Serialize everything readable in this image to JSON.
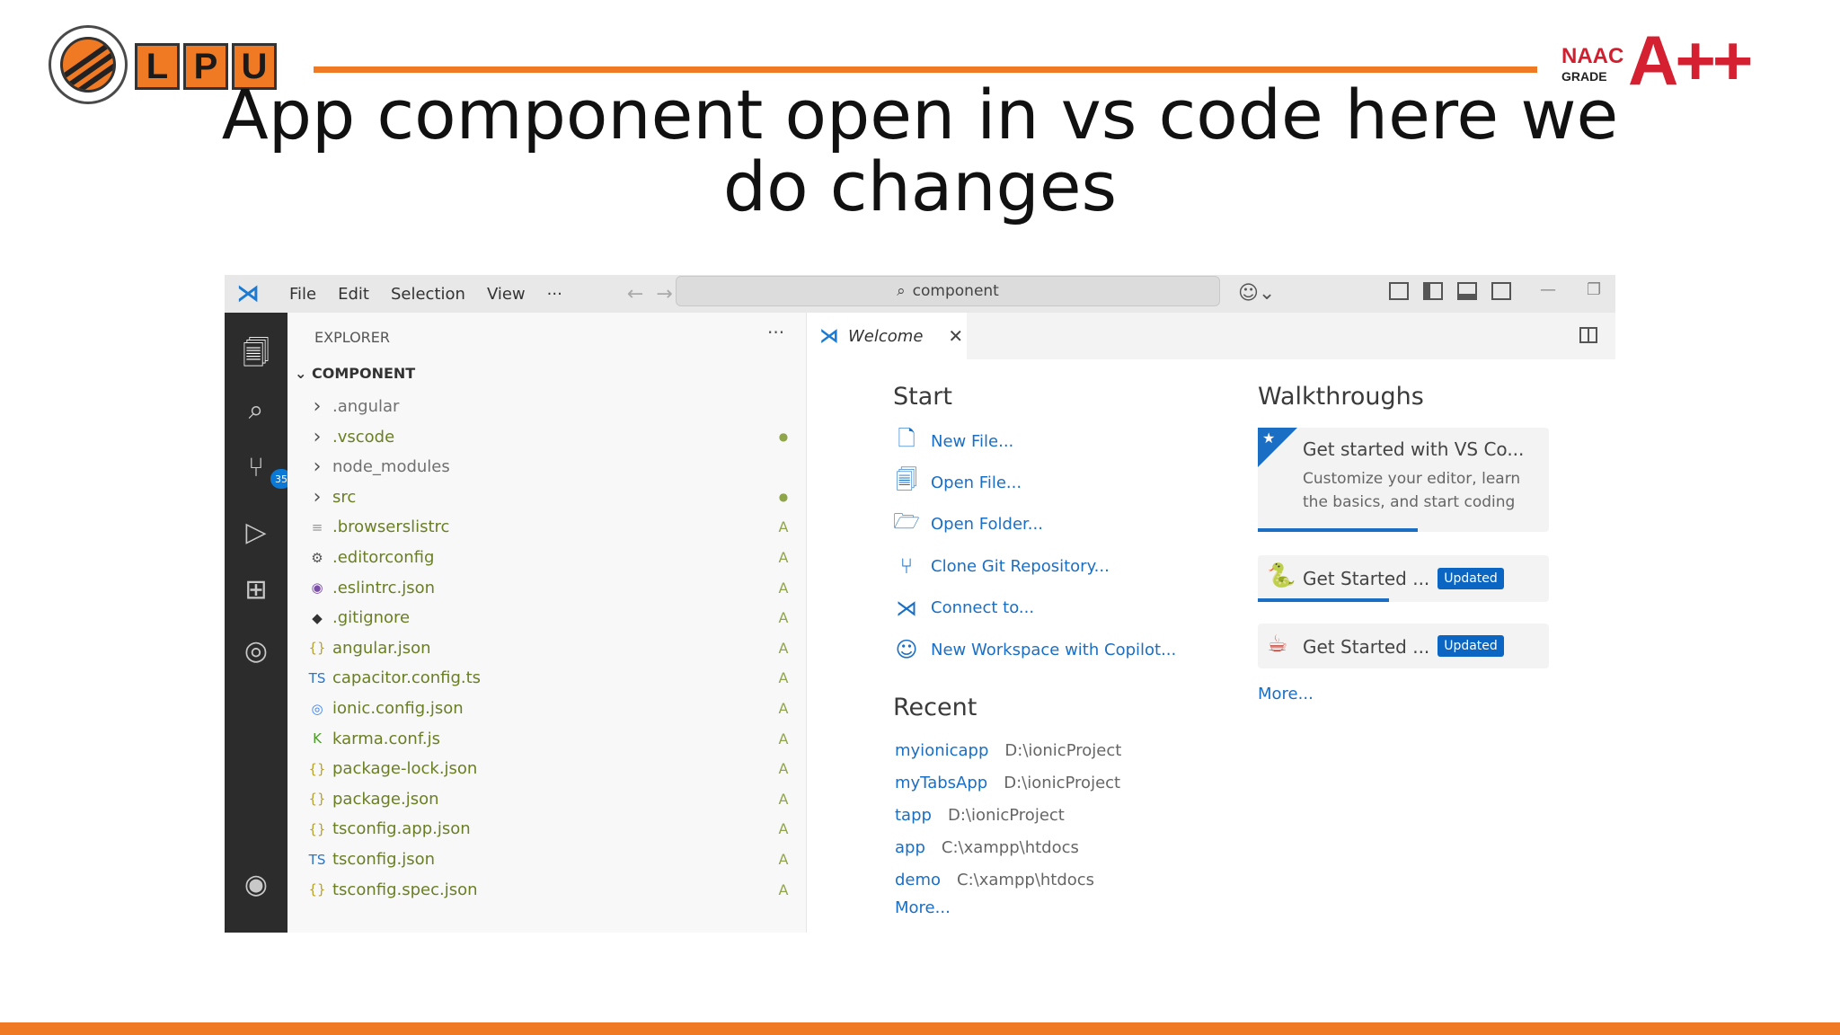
{
  "slide": {
    "title": "App component open in vs code here we do changes",
    "logo_letters": [
      "L",
      "P",
      "U"
    ],
    "naac": "NAAC",
    "naac_grade": "GRADE",
    "grade_mark": "A++"
  },
  "colors": {
    "accent_orange": "#f07a23",
    "vscode_blue": "#1a6fc4",
    "badge_blue": "#0a78d4",
    "git_added": "#8fa54a",
    "naac_red": "#d42030"
  },
  "titlebar": {
    "menu": [
      "File",
      "Edit",
      "Selection",
      "View",
      "···"
    ],
    "search": "component"
  },
  "activity": {
    "scm_badge": "35"
  },
  "explorer": {
    "heading": "EXPLORER",
    "more": "···",
    "root": "COMPONENT",
    "items": [
      {
        "name": ".angular",
        "type": "folder",
        "icon": "chevron-right-icon",
        "glyph": "›",
        "status": ""
      },
      {
        "name": ".vscode",
        "type": "folder-mod",
        "icon": "chevron-right-icon",
        "glyph": "›",
        "status": "●"
      },
      {
        "name": "node_modules",
        "type": "folder",
        "icon": "chevron-right-icon",
        "glyph": "›",
        "status": ""
      },
      {
        "name": "src",
        "type": "folder-mod",
        "icon": "chevron-right-icon",
        "glyph": "›",
        "status": "●"
      },
      {
        "name": ".browserslistrc",
        "type": "file",
        "icon": "lines-file-icon",
        "glyph": "≡",
        "status": "A"
      },
      {
        "name": ".editorconfig",
        "type": "file",
        "icon": "gear-file-icon",
        "glyph": "⚙",
        "status": "A"
      },
      {
        "name": ".eslintrc.json",
        "type": "file",
        "icon": "eslint-file-icon",
        "glyph": "◉",
        "status": "A"
      },
      {
        "name": ".gitignore",
        "type": "file",
        "icon": "git-file-icon",
        "glyph": "◆",
        "status": "A"
      },
      {
        "name": "angular.json",
        "type": "file",
        "icon": "json-file-icon",
        "glyph": "{}",
        "status": "A"
      },
      {
        "name": "capacitor.config.ts",
        "type": "file",
        "icon": "ts-file-icon",
        "glyph": "TS",
        "status": "A"
      },
      {
        "name": "ionic.config.json",
        "type": "file",
        "icon": "ionic-file-icon",
        "glyph": "◎",
        "status": "A"
      },
      {
        "name": "karma.conf.js",
        "type": "file",
        "icon": "karma-file-icon",
        "glyph": "K",
        "status": "A"
      },
      {
        "name": "package-lock.json",
        "type": "file",
        "icon": "json-file-icon",
        "glyph": "{}",
        "status": "A"
      },
      {
        "name": "package.json",
        "type": "file",
        "icon": "json-file-icon",
        "glyph": "{}",
        "status": "A"
      },
      {
        "name": "tsconfig.app.json",
        "type": "file",
        "icon": "json-file-icon",
        "glyph": "{}",
        "status": "A"
      },
      {
        "name": "tsconfig.json",
        "type": "file",
        "icon": "tsconfig-file-icon",
        "glyph": "TS",
        "status": "A"
      },
      {
        "name": "tsconfig.spec.json",
        "type": "file",
        "icon": "json-file-icon",
        "glyph": "{}",
        "status": "A"
      }
    ]
  },
  "editor": {
    "tab": {
      "label": "Welcome",
      "close": "✕"
    },
    "start": {
      "heading": "Start",
      "items": [
        {
          "label": "New File...",
          "glyph": "🗋",
          "name": "new-file"
        },
        {
          "label": "Open File...",
          "glyph": "🗐",
          "name": "open-file"
        },
        {
          "label": "Open Folder...",
          "glyph": "🗁",
          "name": "open-folder"
        },
        {
          "label": "Clone Git Repository...",
          "glyph": "⑂",
          "name": "clone-git-repository"
        },
        {
          "label": "Connect to...",
          "glyph": "⋊",
          "name": "connect-to"
        },
        {
          "label": "New Workspace with Copilot...",
          "glyph": "☺",
          "name": "new-workspace-copilot"
        }
      ]
    },
    "recent": {
      "heading": "Recent",
      "items": [
        {
          "name": "myionicapp",
          "path": "D:\\ionicProject"
        },
        {
          "name": "myTabsApp",
          "path": "D:\\ionicProject"
        },
        {
          "name": "tapp",
          "path": "D:\\ionicProject"
        },
        {
          "name": "app",
          "path": "C:\\xampp\\htdocs"
        },
        {
          "name": "demo",
          "path": "C:\\xampp\\htdocs"
        }
      ],
      "more": "More..."
    },
    "walkthroughs": {
      "heading": "Walkthroughs",
      "cards": [
        {
          "title": "Get started with VS Co...",
          "description": "Customize your editor, learn the basics, and start coding",
          "progress": 0.55,
          "badge": ""
        },
        {
          "title": "Get Started ...",
          "description": "",
          "progress": 0.45,
          "badge": "Updated"
        },
        {
          "title": "Get Started ...",
          "description": "",
          "progress": 0,
          "badge": "Updated"
        }
      ],
      "more": "More..."
    }
  }
}
